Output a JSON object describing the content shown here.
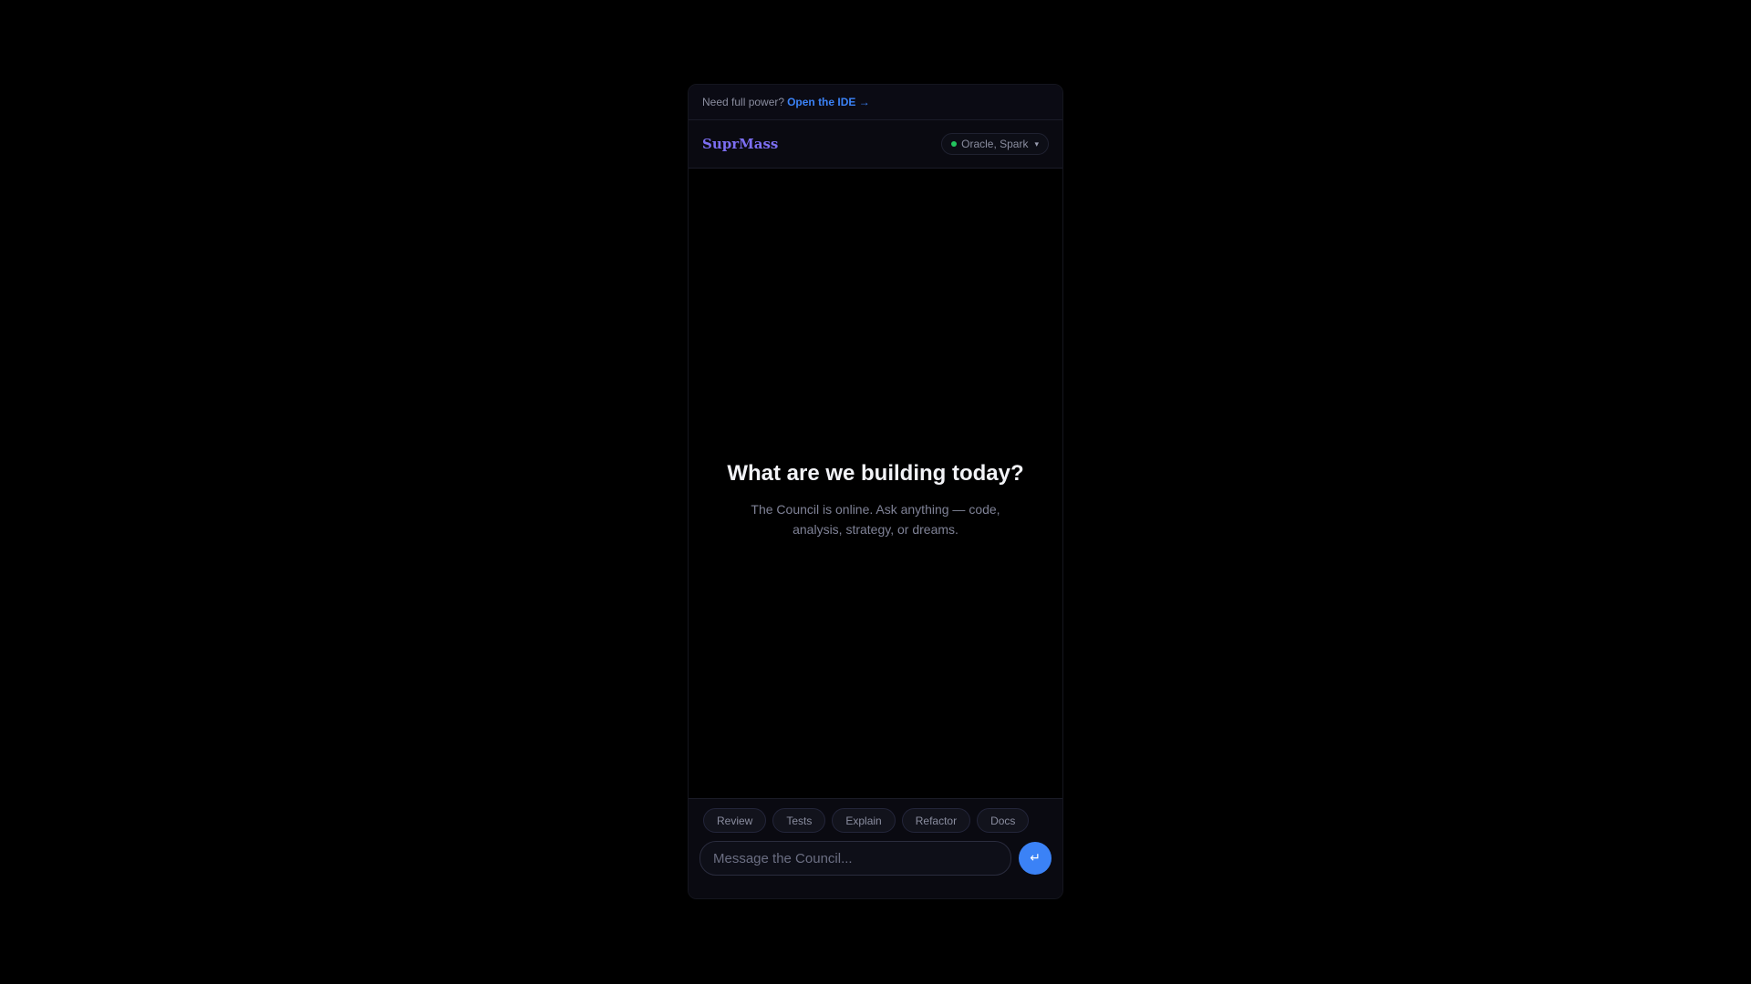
{
  "banner": {
    "text": "Need full power?",
    "link_label": "Open the IDE →"
  },
  "header": {
    "brand": "SuprMass",
    "model_selector": {
      "label": "Oracle, Spark",
      "status_color": "#22c55e",
      "chevron": "▾"
    }
  },
  "main": {
    "title": "What are we building today?",
    "subtitle": "The Council is online. Ask anything — code, analysis, strategy, or dreams."
  },
  "composer": {
    "chips": [
      "Review",
      "Tests",
      "Explain",
      "Refactor",
      "Docs"
    ],
    "input": {
      "placeholder": "Message the Council...",
      "value": ""
    },
    "send_icon": "↵"
  },
  "colors": {
    "accent": "#3b82f6",
    "brand": "#7c6ef2",
    "background": "#000000"
  }
}
